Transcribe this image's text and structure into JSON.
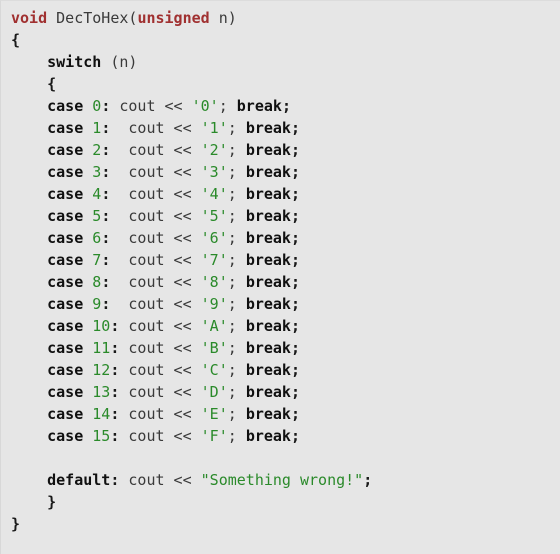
{
  "editor": {
    "background_color": "#e6e6e6",
    "language": "C++",
    "colors": {
      "type_keyword": "#a03030",
      "control_keyword": "#101010",
      "literal": "#2a8a2a",
      "plain": "#3a3a3a"
    }
  },
  "code": {
    "lines": [
      {
        "id": "line-1",
        "tokens": [
          {
            "text": "void",
            "kind": "type"
          },
          {
            "text": " ",
            "kind": "plain"
          },
          {
            "text": "DecToHex",
            "kind": "ident"
          },
          {
            "text": "(",
            "kind": "plain"
          },
          {
            "text": "unsigned",
            "kind": "type"
          },
          {
            "text": " n)",
            "kind": "plain"
          }
        ]
      },
      {
        "id": "line-2",
        "tokens": [
          {
            "text": "{",
            "kind": "punct"
          }
        ]
      },
      {
        "id": "line-3",
        "tokens": [
          {
            "text": "    ",
            "kind": "plain"
          },
          {
            "text": "switch",
            "kind": "keyword"
          },
          {
            "text": " (n)",
            "kind": "plain"
          }
        ]
      },
      {
        "id": "line-4",
        "tokens": [
          {
            "text": "    ",
            "kind": "plain"
          },
          {
            "text": "{",
            "kind": "punct"
          }
        ]
      },
      {
        "id": "line-5",
        "tokens": [
          {
            "text": "    ",
            "kind": "plain"
          },
          {
            "text": "case",
            "kind": "keyword"
          },
          {
            "text": " ",
            "kind": "plain"
          },
          {
            "text": "0",
            "kind": "literal"
          },
          {
            "text": ":",
            "kind": "punct"
          },
          {
            "text": " cout << ",
            "kind": "plain"
          },
          {
            "text": "'0'",
            "kind": "literal"
          },
          {
            "text": "; ",
            "kind": "plain"
          },
          {
            "text": "break",
            "kind": "keyword"
          },
          {
            "text": ";",
            "kind": "punct"
          }
        ]
      },
      {
        "id": "line-6",
        "tokens": [
          {
            "text": "    ",
            "kind": "plain"
          },
          {
            "text": "case",
            "kind": "keyword"
          },
          {
            "text": " ",
            "kind": "plain"
          },
          {
            "text": "1",
            "kind": "literal"
          },
          {
            "text": ":",
            "kind": "punct"
          },
          {
            "text": "  cout << ",
            "kind": "plain"
          },
          {
            "text": "'1'",
            "kind": "literal"
          },
          {
            "text": "; ",
            "kind": "plain"
          },
          {
            "text": "break",
            "kind": "keyword"
          },
          {
            "text": ";",
            "kind": "punct"
          }
        ]
      },
      {
        "id": "line-7",
        "tokens": [
          {
            "text": "    ",
            "kind": "plain"
          },
          {
            "text": "case",
            "kind": "keyword"
          },
          {
            "text": " ",
            "kind": "plain"
          },
          {
            "text": "2",
            "kind": "literal"
          },
          {
            "text": ":",
            "kind": "punct"
          },
          {
            "text": "  cout << ",
            "kind": "plain"
          },
          {
            "text": "'2'",
            "kind": "literal"
          },
          {
            "text": "; ",
            "kind": "plain"
          },
          {
            "text": "break",
            "kind": "keyword"
          },
          {
            "text": ";",
            "kind": "punct"
          }
        ]
      },
      {
        "id": "line-8",
        "tokens": [
          {
            "text": "    ",
            "kind": "plain"
          },
          {
            "text": "case",
            "kind": "keyword"
          },
          {
            "text": " ",
            "kind": "plain"
          },
          {
            "text": "3",
            "kind": "literal"
          },
          {
            "text": ":",
            "kind": "punct"
          },
          {
            "text": "  cout << ",
            "kind": "plain"
          },
          {
            "text": "'3'",
            "kind": "literal"
          },
          {
            "text": "; ",
            "kind": "plain"
          },
          {
            "text": "break",
            "kind": "keyword"
          },
          {
            "text": ";",
            "kind": "punct"
          }
        ]
      },
      {
        "id": "line-9",
        "tokens": [
          {
            "text": "    ",
            "kind": "plain"
          },
          {
            "text": "case",
            "kind": "keyword"
          },
          {
            "text": " ",
            "kind": "plain"
          },
          {
            "text": "4",
            "kind": "literal"
          },
          {
            "text": ":",
            "kind": "punct"
          },
          {
            "text": "  cout << ",
            "kind": "plain"
          },
          {
            "text": "'4'",
            "kind": "literal"
          },
          {
            "text": "; ",
            "kind": "plain"
          },
          {
            "text": "break",
            "kind": "keyword"
          },
          {
            "text": ";",
            "kind": "punct"
          }
        ]
      },
      {
        "id": "line-10",
        "tokens": [
          {
            "text": "    ",
            "kind": "plain"
          },
          {
            "text": "case",
            "kind": "keyword"
          },
          {
            "text": " ",
            "kind": "plain"
          },
          {
            "text": "5",
            "kind": "literal"
          },
          {
            "text": ":",
            "kind": "punct"
          },
          {
            "text": "  cout << ",
            "kind": "plain"
          },
          {
            "text": "'5'",
            "kind": "literal"
          },
          {
            "text": "; ",
            "kind": "plain"
          },
          {
            "text": "break",
            "kind": "keyword"
          },
          {
            "text": ";",
            "kind": "punct"
          }
        ]
      },
      {
        "id": "line-11",
        "tokens": [
          {
            "text": "    ",
            "kind": "plain"
          },
          {
            "text": "case",
            "kind": "keyword"
          },
          {
            "text": " ",
            "kind": "plain"
          },
          {
            "text": "6",
            "kind": "literal"
          },
          {
            "text": ":",
            "kind": "punct"
          },
          {
            "text": "  cout << ",
            "kind": "plain"
          },
          {
            "text": "'6'",
            "kind": "literal"
          },
          {
            "text": "; ",
            "kind": "plain"
          },
          {
            "text": "break",
            "kind": "keyword"
          },
          {
            "text": ";",
            "kind": "punct"
          }
        ]
      },
      {
        "id": "line-12",
        "tokens": [
          {
            "text": "    ",
            "kind": "plain"
          },
          {
            "text": "case",
            "kind": "keyword"
          },
          {
            "text": " ",
            "kind": "plain"
          },
          {
            "text": "7",
            "kind": "literal"
          },
          {
            "text": ":",
            "kind": "punct"
          },
          {
            "text": "  cout << ",
            "kind": "plain"
          },
          {
            "text": "'7'",
            "kind": "literal"
          },
          {
            "text": "; ",
            "kind": "plain"
          },
          {
            "text": "break",
            "kind": "keyword"
          },
          {
            "text": ";",
            "kind": "punct"
          }
        ]
      },
      {
        "id": "line-13",
        "tokens": [
          {
            "text": "    ",
            "kind": "plain"
          },
          {
            "text": "case",
            "kind": "keyword"
          },
          {
            "text": " ",
            "kind": "plain"
          },
          {
            "text": "8",
            "kind": "literal"
          },
          {
            "text": ":",
            "kind": "punct"
          },
          {
            "text": "  cout << ",
            "kind": "plain"
          },
          {
            "text": "'8'",
            "kind": "literal"
          },
          {
            "text": "; ",
            "kind": "plain"
          },
          {
            "text": "break",
            "kind": "keyword"
          },
          {
            "text": ";",
            "kind": "punct"
          }
        ]
      },
      {
        "id": "line-14",
        "tokens": [
          {
            "text": "    ",
            "kind": "plain"
          },
          {
            "text": "case",
            "kind": "keyword"
          },
          {
            "text": " ",
            "kind": "plain"
          },
          {
            "text": "9",
            "kind": "literal"
          },
          {
            "text": ":",
            "kind": "punct"
          },
          {
            "text": "  cout << ",
            "kind": "plain"
          },
          {
            "text": "'9'",
            "kind": "literal"
          },
          {
            "text": "; ",
            "kind": "plain"
          },
          {
            "text": "break",
            "kind": "keyword"
          },
          {
            "text": ";",
            "kind": "punct"
          }
        ]
      },
      {
        "id": "line-15",
        "tokens": [
          {
            "text": "    ",
            "kind": "plain"
          },
          {
            "text": "case",
            "kind": "keyword"
          },
          {
            "text": " ",
            "kind": "plain"
          },
          {
            "text": "10",
            "kind": "literal"
          },
          {
            "text": ":",
            "kind": "punct"
          },
          {
            "text": " cout << ",
            "kind": "plain"
          },
          {
            "text": "'A'",
            "kind": "literal"
          },
          {
            "text": "; ",
            "kind": "plain"
          },
          {
            "text": "break",
            "kind": "keyword"
          },
          {
            "text": ";",
            "kind": "punct"
          }
        ]
      },
      {
        "id": "line-16",
        "tokens": [
          {
            "text": "    ",
            "kind": "plain"
          },
          {
            "text": "case",
            "kind": "keyword"
          },
          {
            "text": " ",
            "kind": "plain"
          },
          {
            "text": "11",
            "kind": "literal"
          },
          {
            "text": ":",
            "kind": "punct"
          },
          {
            "text": " cout << ",
            "kind": "plain"
          },
          {
            "text": "'B'",
            "kind": "literal"
          },
          {
            "text": "; ",
            "kind": "plain"
          },
          {
            "text": "break",
            "kind": "keyword"
          },
          {
            "text": ";",
            "kind": "punct"
          }
        ]
      },
      {
        "id": "line-17",
        "tokens": [
          {
            "text": "    ",
            "kind": "plain"
          },
          {
            "text": "case",
            "kind": "keyword"
          },
          {
            "text": " ",
            "kind": "plain"
          },
          {
            "text": "12",
            "kind": "literal"
          },
          {
            "text": ":",
            "kind": "punct"
          },
          {
            "text": " cout << ",
            "kind": "plain"
          },
          {
            "text": "'C'",
            "kind": "literal"
          },
          {
            "text": "; ",
            "kind": "plain"
          },
          {
            "text": "break",
            "kind": "keyword"
          },
          {
            "text": ";",
            "kind": "punct"
          }
        ]
      },
      {
        "id": "line-18",
        "tokens": [
          {
            "text": "    ",
            "kind": "plain"
          },
          {
            "text": "case",
            "kind": "keyword"
          },
          {
            "text": " ",
            "kind": "plain"
          },
          {
            "text": "13",
            "kind": "literal"
          },
          {
            "text": ":",
            "kind": "punct"
          },
          {
            "text": " cout << ",
            "kind": "plain"
          },
          {
            "text": "'D'",
            "kind": "literal"
          },
          {
            "text": "; ",
            "kind": "plain"
          },
          {
            "text": "break",
            "kind": "keyword"
          },
          {
            "text": ";",
            "kind": "punct"
          }
        ]
      },
      {
        "id": "line-19",
        "tokens": [
          {
            "text": "    ",
            "kind": "plain"
          },
          {
            "text": "case",
            "kind": "keyword"
          },
          {
            "text": " ",
            "kind": "plain"
          },
          {
            "text": "14",
            "kind": "literal"
          },
          {
            "text": ":",
            "kind": "punct"
          },
          {
            "text": " cout << ",
            "kind": "plain"
          },
          {
            "text": "'E'",
            "kind": "literal"
          },
          {
            "text": "; ",
            "kind": "plain"
          },
          {
            "text": "break",
            "kind": "keyword"
          },
          {
            "text": ";",
            "kind": "punct"
          }
        ]
      },
      {
        "id": "line-20",
        "tokens": [
          {
            "text": "    ",
            "kind": "plain"
          },
          {
            "text": "case",
            "kind": "keyword"
          },
          {
            "text": " ",
            "kind": "plain"
          },
          {
            "text": "15",
            "kind": "literal"
          },
          {
            "text": ":",
            "kind": "punct"
          },
          {
            "text": " cout << ",
            "kind": "plain"
          },
          {
            "text": "'F'",
            "kind": "literal"
          },
          {
            "text": "; ",
            "kind": "plain"
          },
          {
            "text": "break",
            "kind": "keyword"
          },
          {
            "text": ";",
            "kind": "punct"
          }
        ]
      },
      {
        "id": "line-21",
        "tokens": []
      },
      {
        "id": "line-22",
        "tokens": [
          {
            "text": "    ",
            "kind": "plain"
          },
          {
            "text": "default",
            "kind": "keyword"
          },
          {
            "text": ":",
            "kind": "punct"
          },
          {
            "text": " cout << ",
            "kind": "plain"
          },
          {
            "text": "\"Something wrong!\"",
            "kind": "literal"
          },
          {
            "text": ";",
            "kind": "punct"
          }
        ]
      },
      {
        "id": "line-23",
        "tokens": [
          {
            "text": "    ",
            "kind": "plain"
          },
          {
            "text": "}",
            "kind": "punct"
          }
        ]
      },
      {
        "id": "line-24",
        "tokens": [
          {
            "text": "}",
            "kind": "punct"
          }
        ]
      }
    ]
  }
}
